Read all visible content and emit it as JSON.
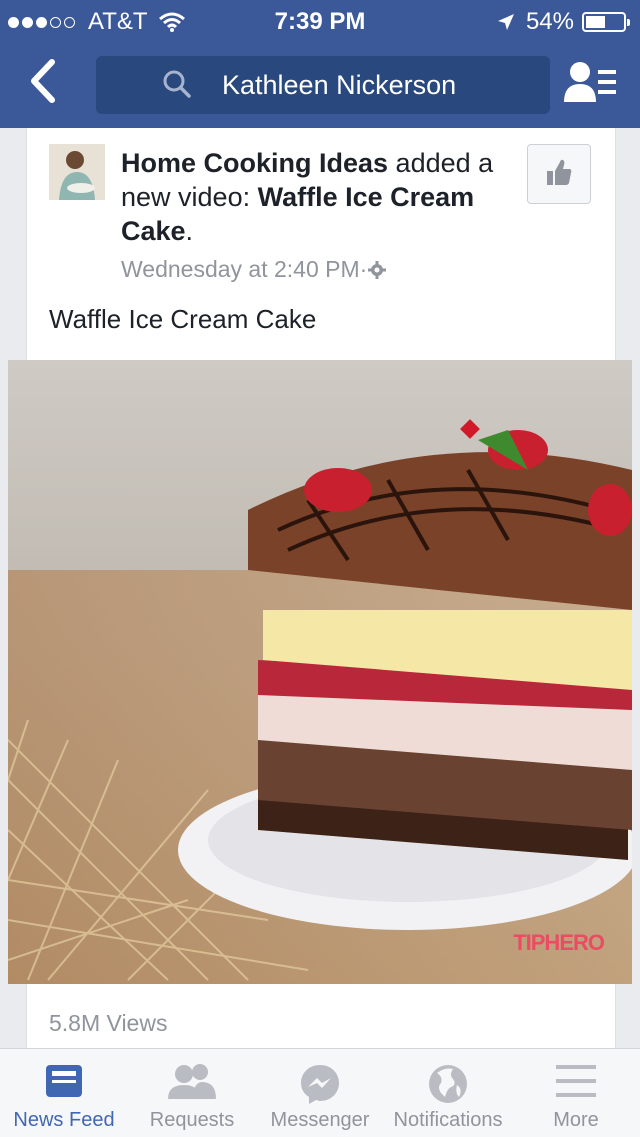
{
  "status": {
    "carrier": "AT&T",
    "time": "7:39 PM",
    "battery": "54%",
    "battery_level": 0.54
  },
  "nav": {
    "search_text": "Kathleen Nickerson"
  },
  "post": {
    "page_name": "Home Cooking Ideas",
    "action_text": " added a new video: ",
    "video_title": "Waffle Ice Cream Cake",
    "period": ".",
    "timestamp": "Wednesday at 2:40 PM",
    "separator": " · ",
    "caption": "Waffle Ice Cream Cake",
    "watermark": "TIPHERO",
    "views": "5.8M Views"
  },
  "tabs": [
    {
      "label": "News Feed",
      "icon": "news-feed-icon",
      "active": true
    },
    {
      "label": "Requests",
      "icon": "friend-requests-icon",
      "active": false
    },
    {
      "label": "Messenger",
      "icon": "messenger-icon",
      "active": false
    },
    {
      "label": "Notifications",
      "icon": "globe-icon",
      "active": false
    },
    {
      "label": "More",
      "icon": "menu-icon",
      "active": false
    }
  ],
  "colors": {
    "brand_blue": "#3b5998",
    "search_bg": "#29487d",
    "active_tab": "#4267b2",
    "muted": "#90949c"
  }
}
